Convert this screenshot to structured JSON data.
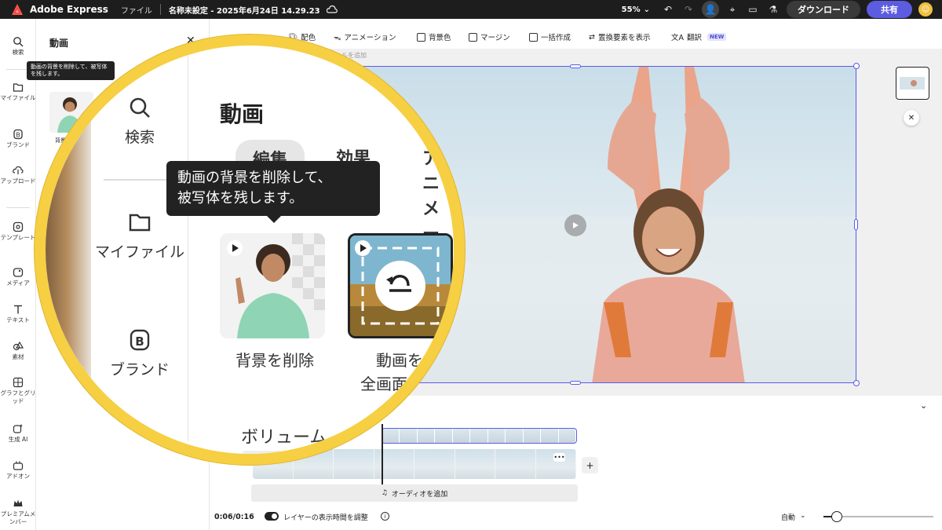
{
  "topbar": {
    "app_name": "Adobe Express",
    "file_menu": "ファイル",
    "doc_title": "名称未設定 - 2025年6月24日 14.29.23",
    "zoom": "55%",
    "download_label": "ダウンロード",
    "share_label": "共有"
  },
  "rail": {
    "items": [
      {
        "label": "検索",
        "icon": "search-icon"
      },
      {
        "label": "マイファイル",
        "icon": "folder-icon"
      },
      {
        "label": "ブランド",
        "icon": "brand-icon"
      },
      {
        "label": "アップロード",
        "icon": "upload-icon"
      },
      {
        "label": "テンプレート",
        "icon": "template-icon"
      },
      {
        "label": "メディア",
        "icon": "media-icon"
      },
      {
        "label": "テキスト",
        "icon": "text-icon"
      },
      {
        "label": "素材",
        "icon": "elements-icon"
      },
      {
        "label": "グラフとグリッド",
        "icon": "grid-icon"
      },
      {
        "label": "生成 AI",
        "icon": "ai-icon"
      },
      {
        "label": "アドオン",
        "icon": "addon-icon"
      },
      {
        "label": "プレミアムメンバー",
        "icon": "crown-icon"
      }
    ]
  },
  "panel": {
    "title": "動画",
    "tabs": [
      "編集",
      "効果",
      "アニメーション"
    ],
    "tooltip": "動画の背景を削除して、被写体を残します。",
    "tooltip_line1": "動画の背景を削除して、",
    "tooltip_line2": "被写体を残します。",
    "cards": [
      {
        "label": "背景を削除"
      },
      {
        "label_line1": "動画を",
        "label_line2": "全画面表示"
      }
    ],
    "volume_label": "ボリューム",
    "small_card_label": "背景"
  },
  "props": {
    "color": "配色",
    "animation": "アニメーション",
    "background": "背景色",
    "margin": "マージン",
    "batch": "一括作成",
    "replace": "置換要素を表示",
    "translate": "翻訳",
    "new_badge": "NEW",
    "hint": "ルを追加"
  },
  "timeline": {
    "audio_label": "オーディオを追加",
    "time": "0:06/0:16",
    "layer_duration": "レイヤーの表示時間を調整",
    "auto": "自動"
  },
  "colors": {
    "accent": "#5b5bea",
    "share": "#5c5ce0",
    "magnifier_ring": "#f6cf43",
    "topbar": "#1d1d1d"
  }
}
